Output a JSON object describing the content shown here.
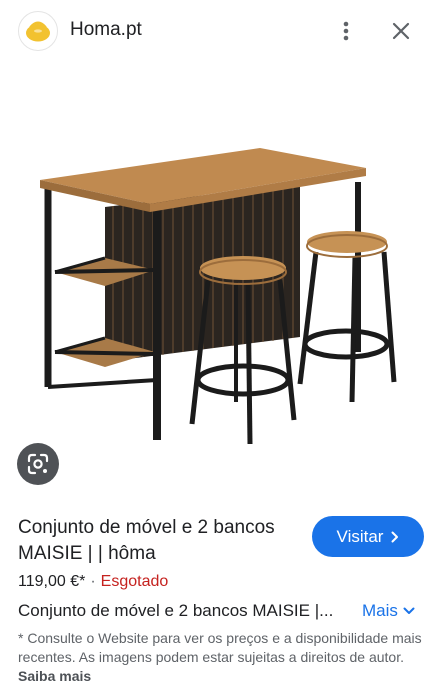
{
  "header": {
    "site_name": "Homa.pt",
    "logo_icon": "homa-logo-icon",
    "menu_icon": "more-vertical-icon",
    "close_icon": "close-icon"
  },
  "image": {
    "alt": "Conjunto de móvel e 2 bancos MAISIE",
    "lens_icon": "google-lens-icon"
  },
  "product": {
    "title": "Conjunto de móvel e 2 bancos MAISIE | | hôma",
    "price": "119,00 €*",
    "separator": "·",
    "availability": "Esgotado",
    "description": "Conjunto de móvel e 2 bancos MAISIE |...",
    "more_label": "Mais",
    "disclaimer": "* Consulte o Website para ver os preços e a disponibilidade mais recentes. As imagens podem estar sujeitas a direitos de autor.",
    "learn_more": "Saiba mais"
  },
  "actions": {
    "visit_label": "Visitar"
  },
  "colors": {
    "accent": "#1a73e8",
    "out_of_stock": "#c5221f",
    "logo_yellow": "#f2c230"
  }
}
